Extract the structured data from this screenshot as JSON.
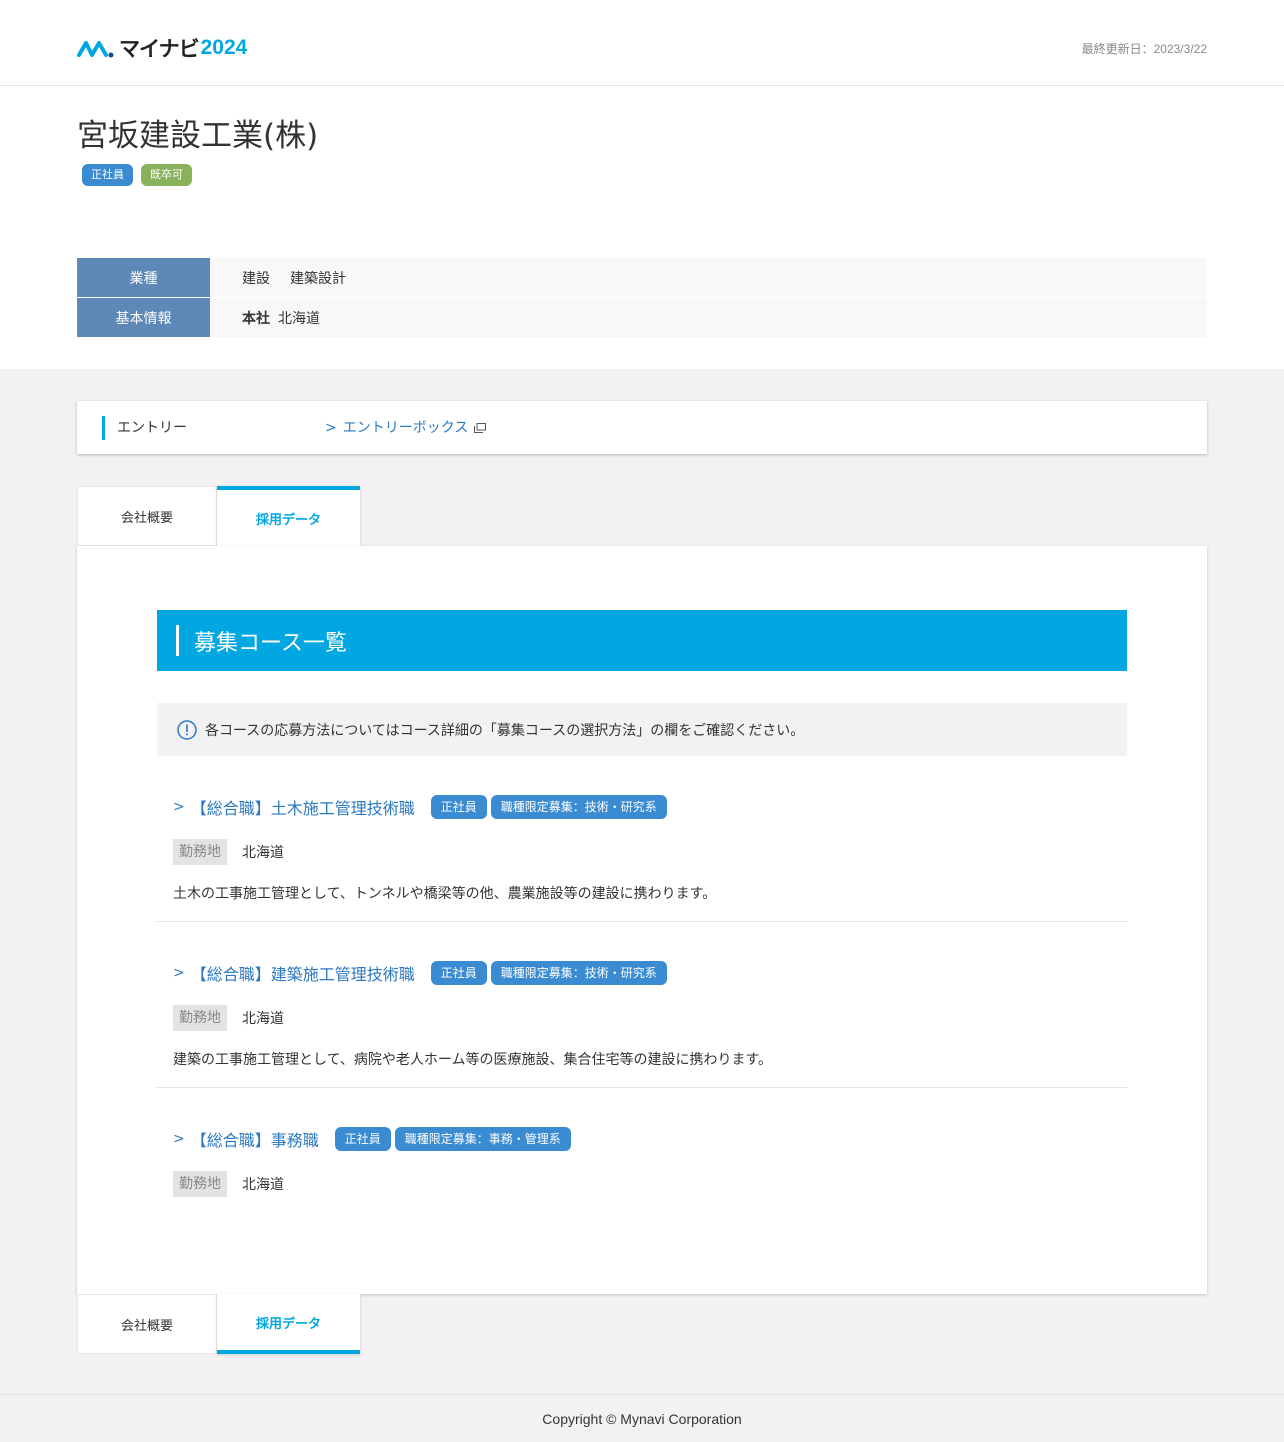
{
  "header": {
    "logo_text": "マイナビ",
    "logo_year": "2024",
    "last_updated": "最終更新日：2023/3/22"
  },
  "company": {
    "name": "宮坂建設工業(株)",
    "tags": [
      "正社員",
      "既卒可"
    ],
    "info": {
      "industry_label": "業種",
      "industry_values": [
        "建設",
        "建築設計"
      ],
      "basic_label": "基本情報",
      "hq_label": "本社",
      "hq_value": "北海道"
    }
  },
  "entry": {
    "label": "エントリー",
    "link_text": "エントリーボックス"
  },
  "tabs": {
    "overview": "会社概要",
    "recruit": "採用データ"
  },
  "courses_section": {
    "title": "募集コース一覧",
    "notice": "各コースの応募方法についてはコース詳細の「募集コースの選択方法」の欄をご確認ください。",
    "location_label": "勤務地",
    "courses": [
      {
        "title": "【総合職】土木施工管理技術職",
        "tags": [
          "正社員",
          "職種限定募集：技術・研究系"
        ],
        "location": "北海道",
        "description": "土木の工事施工管理として、トンネルや橋梁等の他、農業施設等の建設に携わります。"
      },
      {
        "title": "【総合職】建築施工管理技術職",
        "tags": [
          "正社員",
          "職種限定募集：技術・研究系"
        ],
        "location": "北海道",
        "description": "建築の工事施工管理として、病院や老人ホーム等の医療施設、集合住宅等の建設に携わります。"
      },
      {
        "title": "【総合職】事務職",
        "tags": [
          "正社員",
          "職種限定募集：事務・管理系"
        ],
        "location": "北海道",
        "description": ""
      }
    ]
  },
  "footer": {
    "copyright": "Copyright © Mynavi Corporation"
  },
  "colors": {
    "accent": "#00a7e1",
    "label_bg": "#5d88b8",
    "tag_blue": "#3a8bd1",
    "tag_green": "#8ab25a",
    "link": "#2b78c1"
  }
}
